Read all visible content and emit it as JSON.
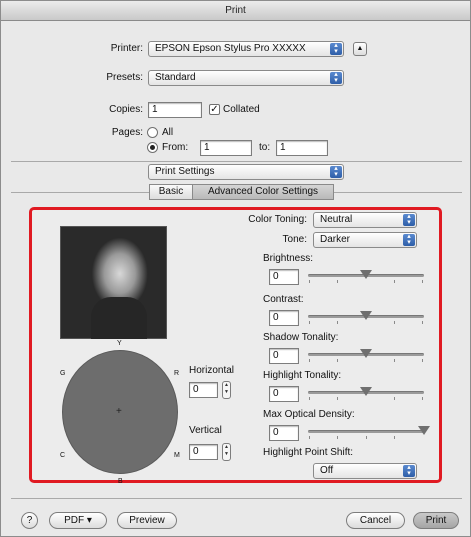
{
  "window": {
    "title": "Print"
  },
  "printer": {
    "label": "Printer:",
    "value": "EPSON Epson Stylus Pro XXXXX"
  },
  "presets": {
    "label": "Presets:",
    "value": "Standard"
  },
  "copies": {
    "label": "Copies:",
    "value": "1",
    "collated_label": "Collated",
    "collated_checked": true
  },
  "pages": {
    "label": "Pages:",
    "all_label": "All",
    "from_label": "From:",
    "from_value": "1",
    "to_label": "to:",
    "to_value": "1",
    "selected": "from"
  },
  "section_popup": {
    "value": "Print Settings"
  },
  "tabs": [
    {
      "label": "Basic",
      "active": false
    },
    {
      "label": "Advanced Color Settings",
      "active": true
    }
  ],
  "advanced": {
    "color_toning": {
      "label": "Color Toning:",
      "value": "Neutral"
    },
    "tone": {
      "label": "Tone:",
      "value": "Darker"
    },
    "brightness": {
      "label": "Brightness:",
      "value": "0",
      "level": 0.5
    },
    "contrast": {
      "label": "Contrast:",
      "value": "0",
      "level": 0.5
    },
    "shadow_tonality": {
      "label": "Shadow Tonality:",
      "value": "0",
      "level": 0.5
    },
    "highlight_tonality": {
      "label": "Highlight Tonality:",
      "value": "0",
      "level": 0.5
    },
    "max_optical_density": {
      "label": "Max Optical Density:",
      "value": "0",
      "level": 1.0
    },
    "highlight_point_shift": {
      "label": "Highlight Point Shift:",
      "value": "Off"
    },
    "color_wheel": {
      "top": "Y",
      "bottom": "B",
      "top_left": "G",
      "top_right": "R",
      "bottom_left": "C",
      "bottom_right": "M"
    },
    "horizontal": {
      "label": "Horizontal",
      "value": "0"
    },
    "vertical": {
      "label": "Vertical",
      "value": "0"
    }
  },
  "footer": {
    "help": "?",
    "pdf": "PDF ▾",
    "preview": "Preview",
    "cancel": "Cancel",
    "print": "Print"
  },
  "colors": {
    "highlight": "#e01a22",
    "popup_arrow": "#2e5ea8"
  }
}
